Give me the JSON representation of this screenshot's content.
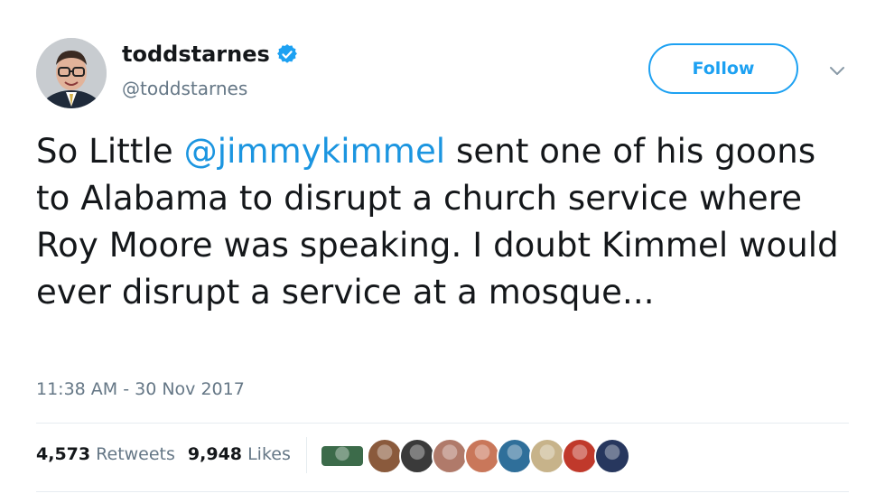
{
  "user": {
    "display_name": "toddstarnes",
    "handle": "@toddstarnes",
    "verified": true
  },
  "actions": {
    "follow_label": "Follow",
    "more_icon": "chevron-down-icon"
  },
  "tweet": {
    "text_before": "So Little ",
    "mention": "@jimmykimmel",
    "text_after": " sent one of his goons to Alabama to disrupt a church service where Roy Moore was speaking. I doubt Kimmel would ever disrupt a service at a mosque...",
    "timestamp": "11:38 AM - 30 Nov 2017"
  },
  "stats": {
    "retweets_count": "4,573",
    "retweets_label": "Retweets",
    "likes_count": "9,948",
    "likes_label": "Likes"
  },
  "liker_avatars": [
    {
      "name": "liker-avatar-1",
      "color": "#3c6b4a"
    },
    {
      "name": "liker-avatar-2",
      "color": "#8a5a3c"
    },
    {
      "name": "liker-avatar-3",
      "color": "#3a3a3a"
    },
    {
      "name": "liker-avatar-4",
      "color": "#b07a6a"
    },
    {
      "name": "liker-avatar-5",
      "color": "#c9775a"
    },
    {
      "name": "liker-avatar-6",
      "color": "#2f6f9a"
    },
    {
      "name": "liker-avatar-7",
      "color": "#c7b38a"
    },
    {
      "name": "liker-avatar-8",
      "color": "#c0392b"
    },
    {
      "name": "liker-avatar-9",
      "color": "#27375e"
    }
  ],
  "colors": {
    "accent": "#1da1f2",
    "mention": "#1b95e0",
    "muted": "#657786",
    "text": "#14171a"
  }
}
